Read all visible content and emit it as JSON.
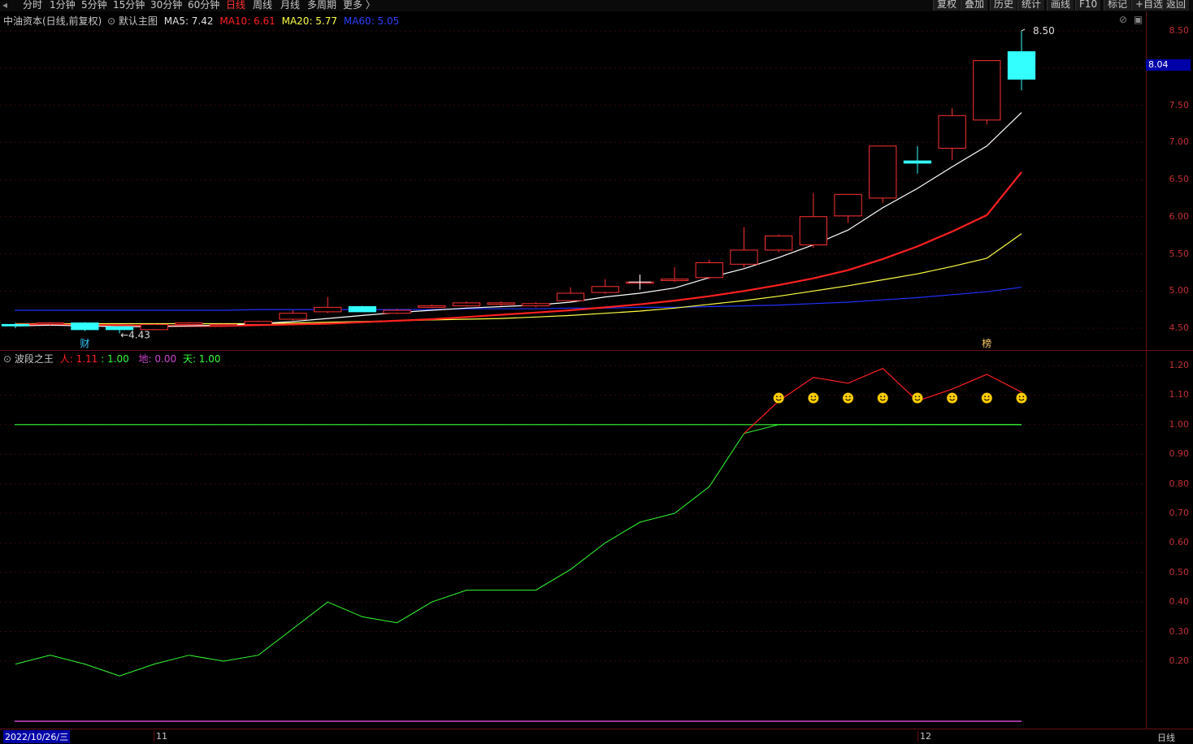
{
  "toolbar": {
    "periods": [
      "分时",
      "1分钟",
      "5分钟",
      "15分钟",
      "30分钟",
      "60分钟",
      "日线",
      "周线",
      "月线",
      "多周期",
      "更多 〉"
    ],
    "active_period": "日线",
    "right_buttons": [
      "复权",
      "叠加",
      "历史",
      "统计",
      "画线",
      "F10",
      "标记",
      "+自选",
      "返回"
    ]
  },
  "main_legend": {
    "stock": "中油资本(日线,前复权)",
    "template": "默认主图",
    "ma5": "MA5: 7.42",
    "ma10": "MA10: 6.61",
    "ma20": "MA20: 5.77",
    "ma60": "MA60: 5.05"
  },
  "sub_legend": {
    "name": "波段之王",
    "ren": "人: 1.11",
    "ren_extra": ": 1.00",
    "di": "地: 0.00",
    "tian": "天: 1.00"
  },
  "colors": {
    "up": "#ff3030",
    "down": "#33ffff",
    "ma5": "#ffffff",
    "ma10": "#ff2020",
    "ma20": "#ffff44",
    "ma60": "#2030ff",
    "ren": "#ff2020",
    "di": "#cc44cc",
    "tian": "#33ff33"
  },
  "main_axis": {
    "ticks": [
      "8.50",
      "8.00",
      "7.50",
      "7.00",
      "6.50",
      "6.00",
      "5.50",
      "5.00",
      "4.50"
    ],
    "current_price": "8.04"
  },
  "sub_axis": {
    "ticks": [
      "1.20",
      "1.10",
      "1.00",
      "0.90",
      "0.80",
      "0.70",
      "0.60",
      "0.50",
      "0.40",
      "0.30",
      "0.20"
    ]
  },
  "annotations": {
    "high": "8.50",
    "low": "←4.43",
    "badge_cai": "财",
    "badge_bang": "榜"
  },
  "xaxis": {
    "date": "2022/10/26/三",
    "m11": "11",
    "m12": "12",
    "period_label": "日线"
  },
  "chart_data": {
    "type": "line",
    "title": "中油资本(日线,前复权)",
    "xlabel": "",
    "ylabel": "",
    "candles": [
      {
        "o": 4.55,
        "h": 4.57,
        "l": 4.5,
        "c": 4.53
      },
      {
        "o": 4.56,
        "h": 4.58,
        "l": 4.53,
        "c": 4.57
      },
      {
        "o": 4.57,
        "h": 4.58,
        "l": 4.46,
        "c": 4.48
      },
      {
        "o": 4.52,
        "h": 4.53,
        "l": 4.43,
        "c": 4.48
      },
      {
        "o": 4.48,
        "h": 4.56,
        "l": 4.47,
        "c": 4.55
      },
      {
        "o": 4.55,
        "h": 4.58,
        "l": 4.54,
        "c": 4.57
      },
      {
        "o": 4.55,
        "h": 4.56,
        "l": 4.53,
        "c": 4.55
      },
      {
        "o": 4.55,
        "h": 4.6,
        "l": 4.54,
        "c": 4.59
      },
      {
        "o": 4.62,
        "h": 4.74,
        "l": 4.6,
        "c": 4.7
      },
      {
        "o": 4.72,
        "h": 4.92,
        "l": 4.7,
        "c": 4.78
      },
      {
        "o": 4.79,
        "h": 4.8,
        "l": 4.72,
        "c": 4.72
      },
      {
        "o": 4.7,
        "h": 4.76,
        "l": 4.69,
        "c": 4.74
      },
      {
        "o": 4.78,
        "h": 4.82,
        "l": 4.77,
        "c": 4.8
      },
      {
        "o": 4.8,
        "h": 4.86,
        "l": 4.79,
        "c": 4.84
      },
      {
        "o": 4.82,
        "h": 4.86,
        "l": 4.8,
        "c": 4.84
      },
      {
        "o": 4.8,
        "h": 4.85,
        "l": 4.78,
        "c": 4.83
      },
      {
        "o": 4.87,
        "h": 5.05,
        "l": 4.86,
        "c": 4.97
      },
      {
        "o": 4.98,
        "h": 5.16,
        "l": 4.96,
        "c": 5.06
      },
      {
        "o": 5.12,
        "h": 5.22,
        "l": 5.02,
        "c": 5.12
      },
      {
        "o": 5.14,
        "h": 5.32,
        "l": 5.12,
        "c": 5.16
      },
      {
        "o": 5.18,
        "h": 5.42,
        "l": 5.16,
        "c": 5.38
      },
      {
        "o": 5.36,
        "h": 5.86,
        "l": 5.32,
        "c": 5.55
      },
      {
        "o": 5.55,
        "h": 5.76,
        "l": 5.52,
        "c": 5.74
      },
      {
        "o": 5.62,
        "h": 6.32,
        "l": 5.58,
        "c": 6.0
      },
      {
        "o": 6.01,
        "h": 6.3,
        "l": 5.92,
        "c": 6.3
      },
      {
        "o": 6.25,
        "h": 6.95,
        "l": 6.18,
        "c": 6.95
      },
      {
        "o": 6.75,
        "h": 6.95,
        "l": 6.58,
        "c": 6.72
      },
      {
        "o": 6.92,
        "h": 7.46,
        "l": 6.76,
        "c": 7.36
      },
      {
        "o": 7.3,
        "h": 8.1,
        "l": 7.24,
        "c": 8.1
      },
      {
        "o": 8.22,
        "h": 8.5,
        "l": 7.7,
        "c": 7.85
      }
    ],
    "ma5": [
      4.53,
      4.54,
      4.53,
      4.52,
      4.52,
      4.53,
      4.54,
      4.56,
      4.59,
      4.63,
      4.67,
      4.71,
      4.74,
      4.77,
      4.79,
      4.81,
      4.85,
      4.92,
      4.97,
      5.04,
      5.18,
      5.3,
      5.45,
      5.62,
      5.82,
      6.12,
      6.38,
      6.67,
      6.95,
      7.4
    ],
    "ma10": [
      4.55,
      4.55,
      4.54,
      4.54,
      4.53,
      4.53,
      4.53,
      4.54,
      4.55,
      4.56,
      4.58,
      4.6,
      4.62,
      4.65,
      4.68,
      4.71,
      4.74,
      4.78,
      4.82,
      4.87,
      4.93,
      5.0,
      5.08,
      5.17,
      5.28,
      5.43,
      5.6,
      5.8,
      6.02,
      6.6
    ],
    "ma20": [
      4.56,
      4.56,
      4.56,
      4.56,
      4.56,
      4.56,
      4.56,
      4.56,
      4.57,
      4.58,
      4.59,
      4.6,
      4.61,
      4.62,
      4.63,
      4.65,
      4.67,
      4.7,
      4.73,
      4.77,
      4.82,
      4.87,
      4.93,
      5.0,
      5.07,
      5.15,
      5.23,
      5.33,
      5.44,
      5.77
    ],
    "ma60": [
      4.74,
      4.74,
      4.74,
      4.74,
      4.74,
      4.74,
      4.74,
      4.75,
      4.75,
      4.75,
      4.75,
      4.75,
      4.75,
      4.76,
      4.76,
      4.76,
      4.77,
      4.77,
      4.78,
      4.78,
      4.79,
      4.8,
      4.81,
      4.83,
      4.85,
      4.88,
      4.91,
      4.95,
      4.99,
      5.05
    ],
    "ylim": [
      4.4,
      8.6
    ],
    "indicator": {
      "tian": [
        0.19,
        0.22,
        0.19,
        0.15,
        0.19,
        0.22,
        0.2,
        0.22,
        0.31,
        0.4,
        0.35,
        0.33,
        0.4,
        0.44,
        0.44,
        0.44,
        0.51,
        0.6,
        0.67,
        0.7,
        0.79,
        0.97,
        1.0,
        1.0,
        1.0,
        1.0,
        1.0,
        1.0,
        1.0,
        1.0
      ],
      "ren": [
        null,
        null,
        null,
        null,
        null,
        null,
        null,
        null,
        null,
        null,
        null,
        null,
        null,
        null,
        null,
        null,
        null,
        null,
        null,
        null,
        null,
        0.97,
        1.08,
        1.16,
        1.14,
        1.19,
        1.08,
        1.12,
        1.17,
        1.11
      ],
      "di": [
        0.0,
        0.0,
        0.0,
        0.0,
        0.0,
        0.0,
        0.0,
        0.0,
        0.0,
        0.0,
        0.0,
        0.0,
        0.0,
        0.0,
        0.0,
        0.0,
        0.0,
        0.0,
        0.0,
        0.0,
        0.0,
        0.0,
        0.0,
        0.0,
        0.0,
        0.0,
        0.0,
        0.0,
        0.0,
        0.0
      ],
      "smileys": [
        22,
        23,
        24,
        25,
        26,
        27,
        28,
        29
      ],
      "ref_line": 1.0,
      "ylim": [
        0.0,
        1.27
      ]
    }
  }
}
